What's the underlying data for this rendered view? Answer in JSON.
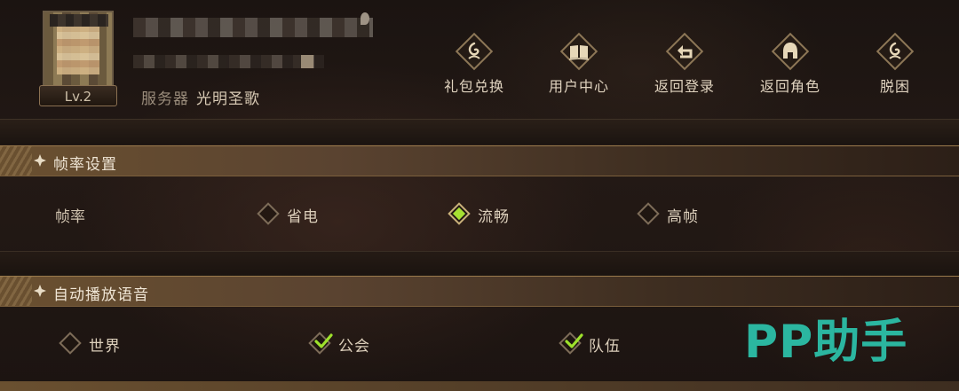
{
  "profile": {
    "level": "Lv.2",
    "server_label": "服务器",
    "server_name": "光明圣歌"
  },
  "actions": [
    {
      "label": "礼包兑换",
      "icon": "gift-code-icon"
    },
    {
      "label": "用户中心",
      "icon": "book-icon"
    },
    {
      "label": "返回登录",
      "icon": "return-arrow-icon"
    },
    {
      "label": "返回角色",
      "icon": "helmet-icon"
    },
    {
      "label": "脱困",
      "icon": "unstuck-icon"
    }
  ],
  "frame_rate": {
    "title": "帧率设置",
    "label": "帧率",
    "options": [
      {
        "label": "省电",
        "selected": false
      },
      {
        "label": "流畅",
        "selected": true
      },
      {
        "label": "高帧",
        "selected": false
      }
    ]
  },
  "auto_voice": {
    "title": "自动播放语音",
    "options": [
      {
        "label": "世界",
        "checked": false
      },
      {
        "label": "公会",
        "checked": true
      },
      {
        "label": "队伍",
        "checked": true
      }
    ]
  },
  "watermark": "PP助手",
  "colors": {
    "accent_green": "#a6e032",
    "check_green": "#9ee12c",
    "watermark": "#2bb6a0"
  }
}
